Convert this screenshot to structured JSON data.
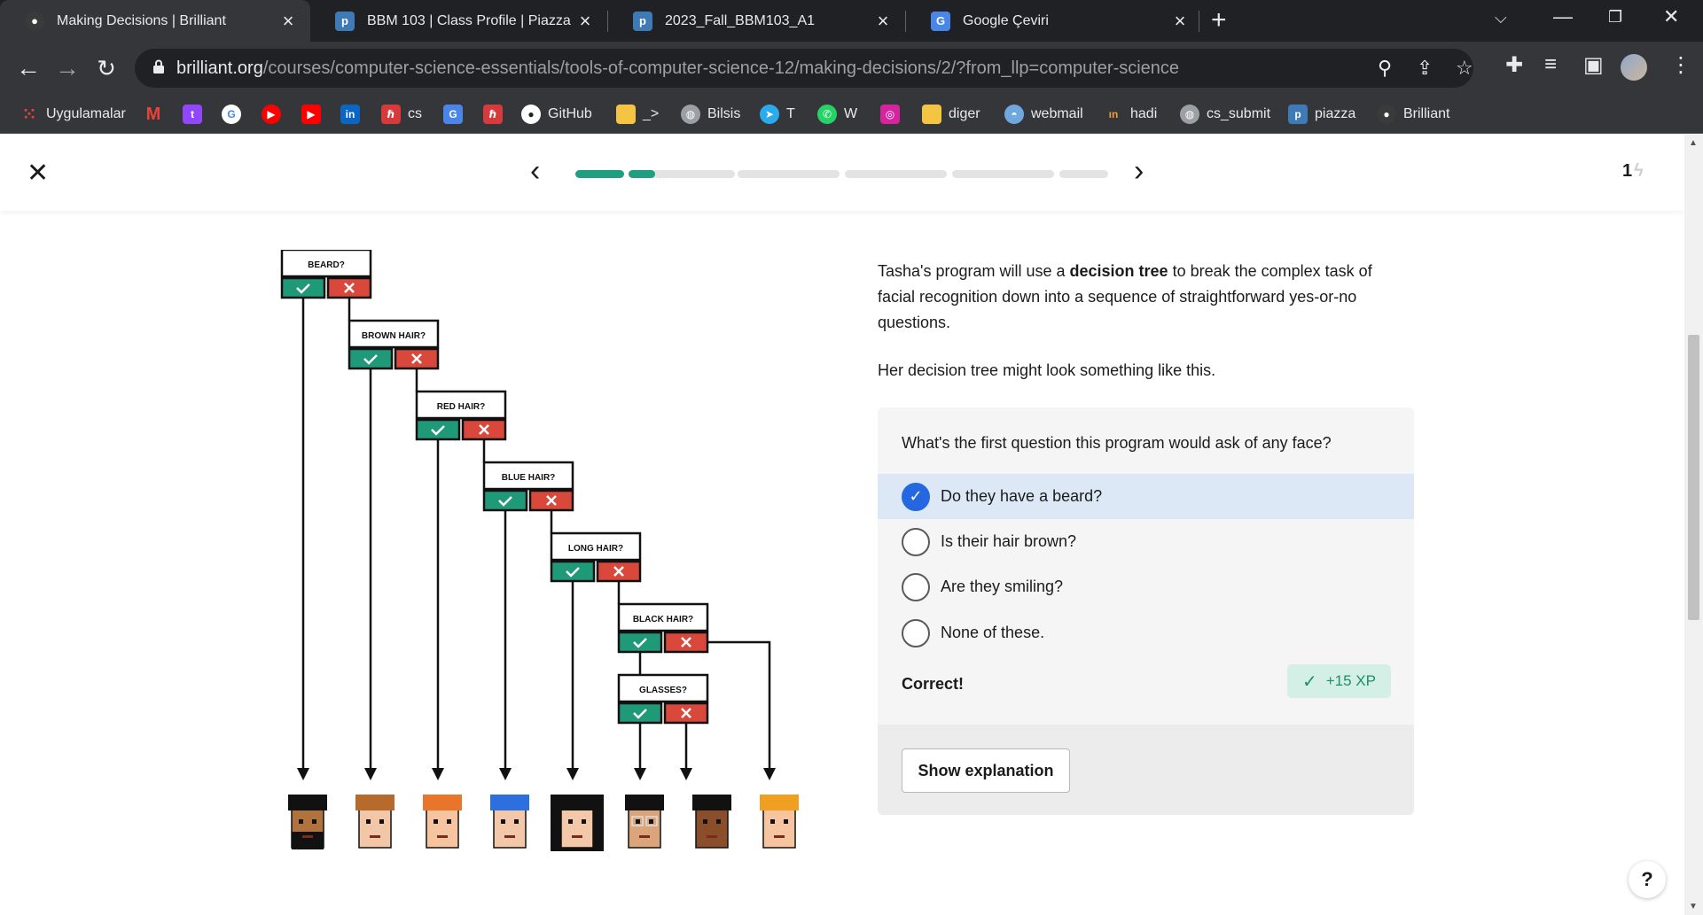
{
  "browser": {
    "tabs": [
      {
        "title": "Making Decisions | Brilliant",
        "icon": "brilliant-icon",
        "active": true
      },
      {
        "title": "BBM 103 | Class Profile | Piazza",
        "icon": "piazza-icon",
        "active": false
      },
      {
        "title": "2023_Fall_BBM103_A1",
        "icon": "piazza-icon",
        "active": false
      },
      {
        "title": "Google Çeviri",
        "icon": "google-translate-icon",
        "active": false
      }
    ],
    "url_host": "brilliant.org",
    "url_path": "/courses/computer-science-essentials/tools-of-computer-science-12/making-decisions/2/?from_llp=computer-science",
    "bookmarks": [
      "Uygulamalar",
      "cs",
      "GitHub",
      "_>",
      "Bilsis",
      "T",
      "W",
      "diger",
      "webmail",
      "hadi",
      "cs_submit",
      "piazza",
      "Brilliant"
    ]
  },
  "lesson": {
    "progress": {
      "segments": 6,
      "completed": 1,
      "current": 2
    },
    "streak": "1",
    "intro_before": "Tasha's program will use a ",
    "intro_bold": "decision tree",
    "intro_after": " to break the complex task of facial recognition down into a sequence of straightforward yes-or-no questions.",
    "intro2": "Her decision tree might look something like this.",
    "question": "What's the first question this program would ask of any face?",
    "options": [
      "Do they have a beard?",
      "Is their hair brown?",
      "Are they smiling?",
      "None of these."
    ],
    "selected_index": 0,
    "result": "Correct!",
    "xp": "+15 XP",
    "explain_button": "Show explanation",
    "help": "?"
  },
  "diagram": {
    "questions": [
      "BEARD?",
      "BROWN HAIR?",
      "RED HAIR?",
      "BLUE HAIR?",
      "LONG HAIR?",
      "BLACK HAIR?",
      "GLASSES?"
    ],
    "colors": {
      "yes": "#1f9a79",
      "no": "#d9483b"
    }
  }
}
